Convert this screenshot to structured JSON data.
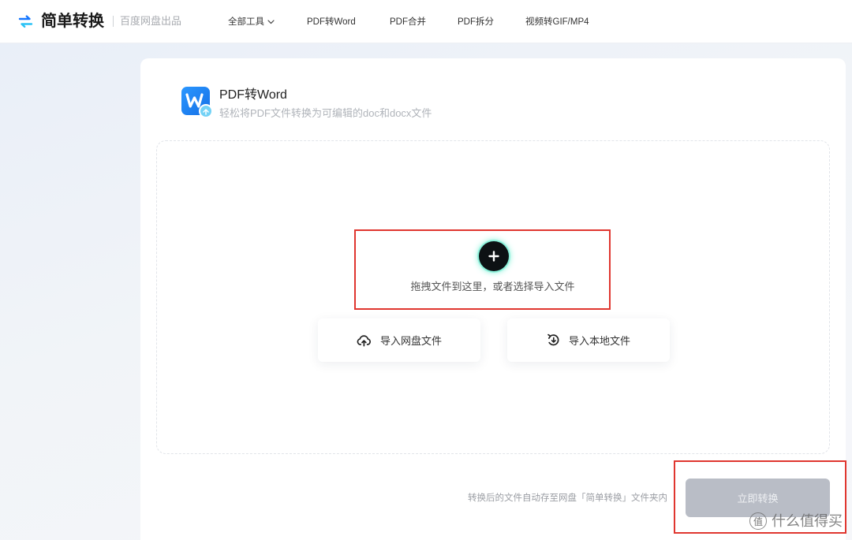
{
  "header": {
    "brand": "简单转换",
    "brand_sub": "百度网盘出品",
    "nav": [
      {
        "label": "全部工具",
        "has_dropdown": true
      },
      {
        "label": "PDF转Word"
      },
      {
        "label": "PDF合并"
      },
      {
        "label": "PDF拆分"
      },
      {
        "label": "视频转GIF/MP4"
      }
    ]
  },
  "tool": {
    "title": "PDF转Word",
    "subtitle": "轻松将PDF文件转换为可编辑的doc和docx文件"
  },
  "dropzone": {
    "hint": "拖拽文件到这里，或者选择导入文件",
    "import_cloud": "导入网盘文件",
    "import_local": "导入本地文件"
  },
  "footer": {
    "note": "转换后的文件自动存至网盘「简单转换」文件夹内",
    "convert_label": "立即转换",
    "convert_disabled": true
  },
  "watermark": {
    "badge": "值",
    "text": "什么值得买"
  },
  "icons": {
    "logo": "swap-arrows-icon",
    "tool": "word-doc-icon",
    "nav_dropdown": "chevron-down-icon",
    "add": "plus-icon",
    "import_cloud": "cloud-upload-icon",
    "import_local": "rotate-import-icon"
  },
  "colors": {
    "brand_blue": "#1677ff",
    "brand_cyan": "#29c2f5",
    "annotation_red": "#e0362f",
    "disabled_button": "#b9bdc6",
    "plus_glow": "#3ee8c2"
  }
}
